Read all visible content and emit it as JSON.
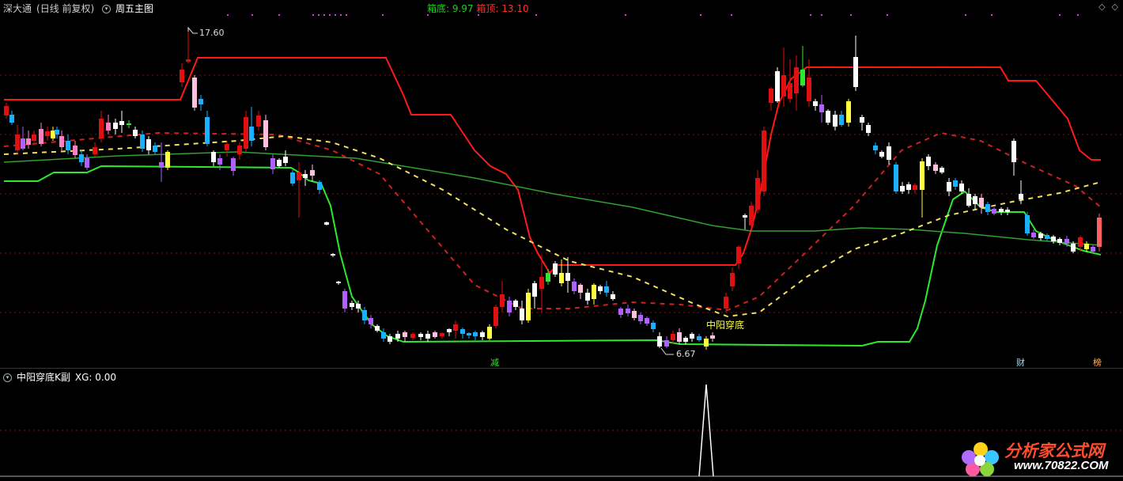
{
  "main": {
    "stock_name": "深大通",
    "period": "(日线 前复权)",
    "title": "周五主图",
    "box_bottom_label": "箱底: 9.97",
    "box_top_label": "箱顶: 13.10",
    "high_marker": "17.60",
    "low_marker": "6.67",
    "pattern_label": "中阳穿底",
    "signal_reduce": "减",
    "signal_finance": "财",
    "signal_list": "榜",
    "arrow_icon": "diamond-icon",
    "collapse_icon": "chevron-down-icon"
  },
  "sub": {
    "indicator_name": "中阳穿底K副",
    "xg_value": "XG: 0.00"
  },
  "watermark": {
    "site_name": "分析家公式网",
    "url": "www.70822.COM"
  },
  "colors": {
    "bg": "#000000",
    "up": "#e01010",
    "down_cyan": "#19b0ff",
    "green_line": "#2ee82e",
    "red_line": "#ff1a1a",
    "yellow": "#ffff40",
    "magenta": "#c060ff",
    "white": "#ffffff"
  },
  "chart_data": {
    "type": "candlestick",
    "high_label": 17.6,
    "low_label": 6.67,
    "box_bottom": 9.97,
    "box_top": 13.1,
    "xg_signal": 0.0
  }
}
